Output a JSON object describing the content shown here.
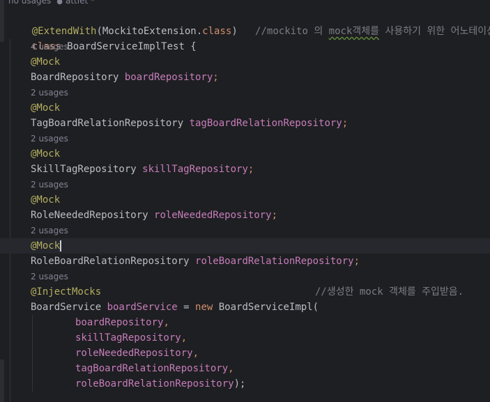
{
  "top_hint": {
    "usages": "no usages",
    "author": "attiet *"
  },
  "code": {
    "ext_annotation": "@ExtendWith",
    "ext_arg_open": "(MockitoExtension.",
    "ext_class_kw": "class",
    "ext_arg_close": ")",
    "ext_comment_pre": "//mockito 의 ",
    "ext_comment_squig": "mock객체를",
    "ext_comment_post": " 사용하기 위한 어노테이션.",
    "class_kw": "class",
    "class_name": " BoardServiceImplTest {",
    "fields": [
      {
        "hint": "4 usages",
        "annotation": "@Mock",
        "type": "BoardRepository ",
        "name": "boardRepository",
        "semi": ";"
      },
      {
        "hint": "2 usages",
        "annotation": "@Mock",
        "type": "TagBoardRelationRepository ",
        "name": "tagBoardRelationRepository",
        "semi": ";"
      },
      {
        "hint": "2 usages",
        "annotation": "@Mock",
        "type": "SkillTagRepository ",
        "name": "skillTagRepository",
        "semi": ";"
      },
      {
        "hint": "2 usages",
        "annotation": "@Mock",
        "type": "RoleNeededRepository ",
        "name": "roleNeededRepository",
        "semi": ";"
      },
      {
        "hint": "2 usages",
        "annotation": "@Mock",
        "type": "RoleBoardRelationRepository ",
        "name": "roleBoardRelationRepository",
        "semi": ";"
      }
    ],
    "inject": {
      "hint": "2 usages",
      "annotation": "@InjectMocks",
      "comment": "//생성한 mock 객체를 주입받음.",
      "type": "BoardService ",
      "name": "boardService",
      "assign": " = ",
      "new_kw": "new",
      "ctor": " BoardServiceImpl(",
      "args": [
        {
          "name": "boardRepository",
          "sep": ","
        },
        {
          "name": "skillTagRepository",
          "sep": ","
        },
        {
          "name": "roleNeededRepository",
          "sep": ","
        },
        {
          "name": "tagBoardRelationRepository",
          "sep": ","
        },
        {
          "name": "roleBoardRelationRepository",
          "sep": ");"
        }
      ]
    }
  },
  "colors": {
    "background": "#1e1f22",
    "annotation": "#b3ae60",
    "keyword": "#cf8e6d",
    "field": "#c77dbb",
    "comment": "#7a7e85",
    "text": "#bcbec4",
    "hint": "#818594"
  }
}
